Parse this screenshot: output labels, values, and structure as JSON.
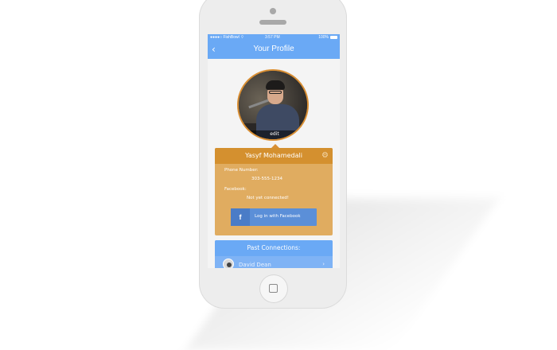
{
  "status_bar": {
    "carrier": "●●●●○ FishBowl ⌔",
    "time": "3:57 PM",
    "battery": "100%"
  },
  "nav": {
    "title": "Your Profile",
    "back_icon": "chevron-left-icon"
  },
  "avatar": {
    "edit_label": "edit"
  },
  "profile": {
    "name": "Yasyf Mohamedali",
    "settings_icon": "gear-icon",
    "phone_label": "Phone Number:",
    "phone_value": "303-555-1234",
    "facebook_label": "Facebook:",
    "facebook_value": "Not yet connected!",
    "fb_button_icon": "f",
    "fb_button_label": "Log in with Facebook"
  },
  "past_connections": {
    "title": "Past Connections:",
    "items": [
      {
        "name": "David Dean"
      }
    ]
  },
  "colors": {
    "nav_blue": "#6aa9f5",
    "card_orange": "#e0ac60",
    "card_header_orange": "#d4902f",
    "facebook_blue": "#5b8fd8"
  }
}
